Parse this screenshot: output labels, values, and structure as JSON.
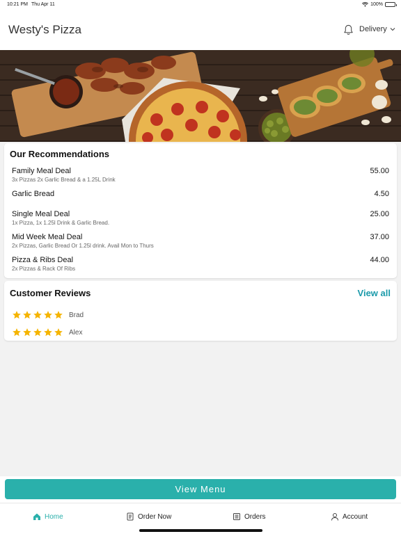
{
  "status": {
    "time": "10:21 PM",
    "date": "Thu Apr 11",
    "battery": "100%"
  },
  "header": {
    "title": "Westy's Pizza",
    "delivery_label": "Delivery"
  },
  "recommendations": {
    "title": "Our Recommendations",
    "items": [
      {
        "name": "Family Meal Deal",
        "desc": "3x Pizzas 2x Garlic Bread & a 1.25L Drink",
        "price": "55.00"
      },
      {
        "name": "Garlic Bread",
        "desc": "",
        "price": "4.50"
      },
      {
        "name": "Single Meal Deal",
        "desc": "1x Pizza, 1x 1.25l Drink & Garlic Bread.",
        "price": "25.00"
      },
      {
        "name": "Mid Week Meal Deal",
        "desc": "2x Pizzas, Garlic Bread Or 1.25l drink. Avail Mon to Thurs",
        "price": "37.00"
      },
      {
        "name": "Pizza & Ribs Deal",
        "desc": "2x Pizzas & Rack Of Ribs",
        "price": "44.00"
      }
    ]
  },
  "reviews": {
    "title": "Customer Reviews",
    "view_all": "View all",
    "items": [
      {
        "name": "Brad",
        "rating": 5
      },
      {
        "name": "Alex",
        "rating": 5
      }
    ]
  },
  "cta": {
    "label": "View Menu"
  },
  "tabs": [
    {
      "label": "Home",
      "icon": "home-icon",
      "active": true
    },
    {
      "label": "Order Now",
      "icon": "order-icon",
      "active": false
    },
    {
      "label": "Orders",
      "icon": "orders-icon",
      "active": false
    },
    {
      "label": "Account",
      "icon": "account-icon",
      "active": false
    }
  ],
  "colors": {
    "accent": "#2ab0ab",
    "link": "#1b9aaa",
    "star": "#f5b400"
  }
}
